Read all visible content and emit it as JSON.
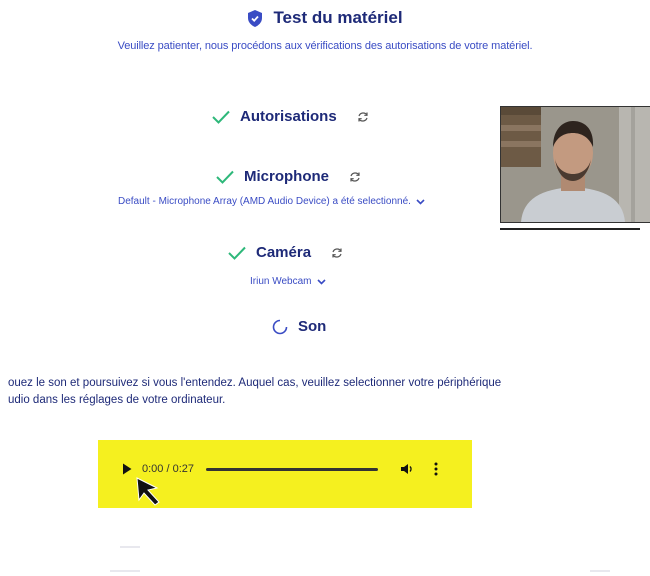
{
  "header": {
    "title": "Test du matériel",
    "subtitle": "Veuillez patienter, nous procédons aux vérifications des autorisations de votre matériel."
  },
  "checks": {
    "authorizations": {
      "label": "Autorisations"
    },
    "microphone": {
      "label": "Microphone",
      "device": "Default - Microphone Array (AMD Audio Device) a été selectionné."
    },
    "camera": {
      "label": "Caméra",
      "device": "Iriun Webcam"
    },
    "sound": {
      "label": "Son"
    }
  },
  "instructions": {
    "line1": "ouez le son et poursuivez si vous l'entendez. Auquel cas, veuillez selectionner votre périphérique",
    "line2": "udio dans les réglages de votre ordinateur."
  },
  "audio_player": {
    "time": "0:00 / 0:27",
    "progress": 0
  },
  "colors": {
    "title": "#1e2a78",
    "link": "#3a4cc4",
    "check": "#2eb87a",
    "highlight": "#f5f01f"
  },
  "icons": [
    "shield-icon",
    "check-icon",
    "refresh-icon",
    "chevron-down-icon",
    "spinner-icon",
    "play-icon",
    "volume-icon",
    "more-vert-icon",
    "mouse-cursor-icon"
  ]
}
